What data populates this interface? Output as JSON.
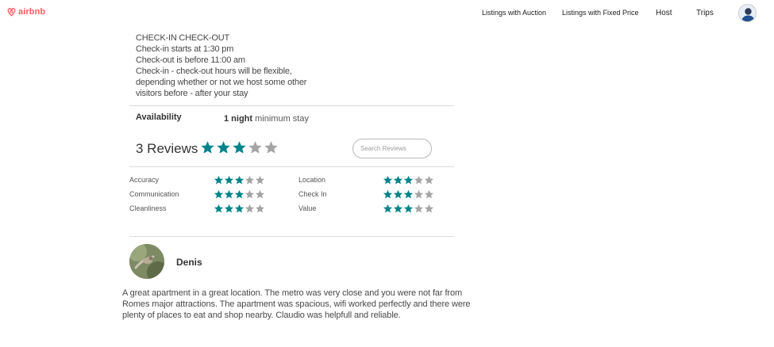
{
  "header": {
    "logo_text": "airbnb",
    "nav": [
      "Listings with Auction",
      "Listings with Fixed Price",
      "Host",
      "Trips"
    ]
  },
  "checkin": {
    "lines": [
      "CHECK-IN CHECK-OUT",
      "Check-in starts at 1:30 pm",
      "Check-out is before 11:00 am",
      "Check-in - check-out hours will be flexible,",
      "depending whether or not we host some other",
      "visitors before - after your stay"
    ]
  },
  "availability": {
    "label": "Availability",
    "nights": "1 night",
    "suffix": " minimum stay"
  },
  "reviews": {
    "count_label": "3 Reviews",
    "overall_rating": 3,
    "max_rating": 5,
    "search_placeholder": "Search Reviews",
    "categories": [
      {
        "label": "Accuracy",
        "rating": 3
      },
      {
        "label": "Communication",
        "rating": 3
      },
      {
        "label": "Cleanliness",
        "rating": 3
      },
      {
        "label": "Location",
        "rating": 3
      },
      {
        "label": "Check In",
        "rating": 3
      },
      {
        "label": "Value",
        "rating": 3
      }
    ],
    "items": [
      {
        "name": "Denis",
        "text_lines": [
          "A great apartment in a great location. The metro was very close and you were not far from",
          "Romes major attractions. The apartment was spacious, wifi worked perfectly and there were",
          "plenty of places to eat and shop nearby. Claudio was helpfull and reliable."
        ]
      }
    ]
  },
  "colors": {
    "brand": "#ff5a5f",
    "star_filled": "#008489",
    "star_empty": "#a4a4a4"
  },
  "icons": {
    "logo": "airbnb-logo-icon",
    "user": "user-avatar-icon",
    "star": "star-icon"
  }
}
